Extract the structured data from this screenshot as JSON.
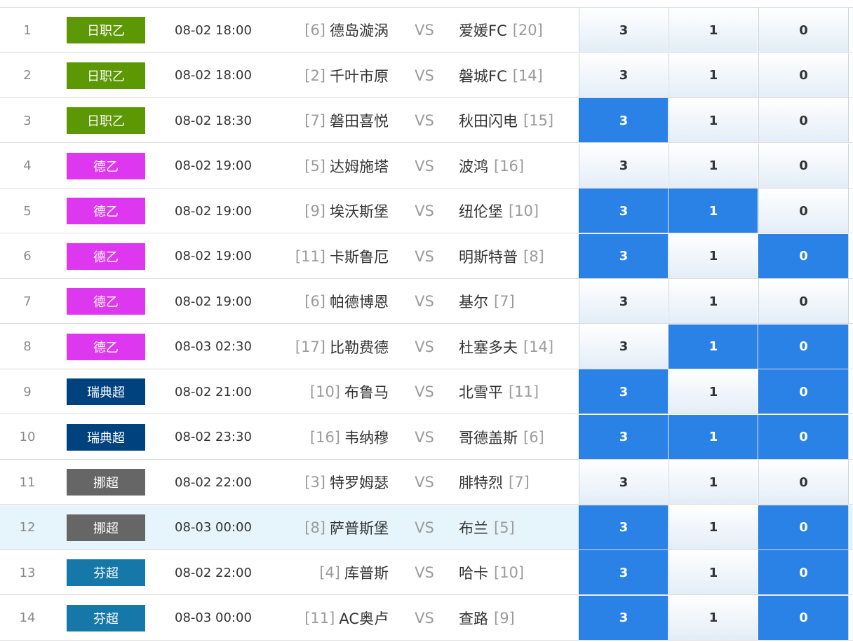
{
  "league_colors": {
    "日职乙": "#5b9803",
    "德乙": "#de37f0",
    "瑞典超": "#00427e",
    "挪超": "#666666",
    "芬超": "#1678a9"
  },
  "selected_color": "#2a81e6",
  "highlighted_row": 12,
  "rows": [
    {
      "num": "1",
      "league": "日职乙",
      "time": "08-02 18:00",
      "home_rank": "[6]",
      "home": "德岛漩涡",
      "vs": "VS",
      "away": "爱媛FC",
      "away_rank": "[20]",
      "odds": [
        "3",
        "1",
        "0"
      ],
      "selected": [
        false,
        false,
        false
      ]
    },
    {
      "num": "2",
      "league": "日职乙",
      "time": "08-02 18:00",
      "home_rank": "[2]",
      "home": "千叶市原",
      "vs": "VS",
      "away": "磐城FC",
      "away_rank": "[14]",
      "odds": [
        "3",
        "1",
        "0"
      ],
      "selected": [
        false,
        false,
        false
      ]
    },
    {
      "num": "3",
      "league": "日职乙",
      "time": "08-02 18:30",
      "home_rank": "[7]",
      "home": "磐田喜悦",
      "vs": "VS",
      "away": "秋田闪电",
      "away_rank": "[15]",
      "odds": [
        "3",
        "1",
        "0"
      ],
      "selected": [
        true,
        false,
        false
      ]
    },
    {
      "num": "4",
      "league": "德乙",
      "time": "08-02 19:00",
      "home_rank": "[5]",
      "home": "达姆施塔",
      "vs": "VS",
      "away": "波鸿",
      "away_rank": "[16]",
      "odds": [
        "3",
        "1",
        "0"
      ],
      "selected": [
        false,
        false,
        false
      ]
    },
    {
      "num": "5",
      "league": "德乙",
      "time": "08-02 19:00",
      "home_rank": "[9]",
      "home": "埃沃斯堡",
      "vs": "VS",
      "away": "纽伦堡",
      "away_rank": "[10]",
      "odds": [
        "3",
        "1",
        "0"
      ],
      "selected": [
        true,
        true,
        false
      ]
    },
    {
      "num": "6",
      "league": "德乙",
      "time": "08-02 19:00",
      "home_rank": "[11]",
      "home": "卡斯鲁厄",
      "vs": "VS",
      "away": "明斯特普",
      "away_rank": "[8]",
      "odds": [
        "3",
        "1",
        "0"
      ],
      "selected": [
        true,
        false,
        true
      ]
    },
    {
      "num": "7",
      "league": "德乙",
      "time": "08-02 19:00",
      "home_rank": "[6]",
      "home": "帕德博恩",
      "vs": "VS",
      "away": "基尔",
      "away_rank": "[7]",
      "odds": [
        "3",
        "1",
        "0"
      ],
      "selected": [
        false,
        false,
        false
      ]
    },
    {
      "num": "8",
      "league": "德乙",
      "time": "08-03 02:30",
      "home_rank": "[17]",
      "home": "比勒费德",
      "vs": "VS",
      "away": "杜塞多夫",
      "away_rank": "[14]",
      "odds": [
        "3",
        "1",
        "0"
      ],
      "selected": [
        false,
        true,
        true
      ]
    },
    {
      "num": "9",
      "league": "瑞典超",
      "time": "08-02 21:00",
      "home_rank": "[10]",
      "home": "布鲁马",
      "vs": "VS",
      "away": "北雪平",
      "away_rank": "[11]",
      "odds": [
        "3",
        "1",
        "0"
      ],
      "selected": [
        true,
        false,
        true
      ]
    },
    {
      "num": "10",
      "league": "瑞典超",
      "time": "08-02 23:30",
      "home_rank": "[16]",
      "home": "韦纳穆",
      "vs": "VS",
      "away": "哥德盖斯",
      "away_rank": "[6]",
      "odds": [
        "3",
        "1",
        "0"
      ],
      "selected": [
        true,
        true,
        true
      ]
    },
    {
      "num": "11",
      "league": "挪超",
      "time": "08-02 22:00",
      "home_rank": "[3]",
      "home": "特罗姆瑟",
      "vs": "VS",
      "away": "腓特烈",
      "away_rank": "[7]",
      "odds": [
        "3",
        "1",
        "0"
      ],
      "selected": [
        false,
        false,
        false
      ]
    },
    {
      "num": "12",
      "league": "挪超",
      "time": "08-03 00:00",
      "home_rank": "[8]",
      "home": "萨普斯堡",
      "vs": "VS",
      "away": "布兰",
      "away_rank": "[5]",
      "odds": [
        "3",
        "1",
        "0"
      ],
      "selected": [
        true,
        false,
        true
      ]
    },
    {
      "num": "13",
      "league": "芬超",
      "time": "08-02 22:00",
      "home_rank": "[4]",
      "home": "库普斯",
      "vs": "VS",
      "away": "哈卡",
      "away_rank": "[10]",
      "odds": [
        "3",
        "1",
        "0"
      ],
      "selected": [
        true,
        false,
        true
      ]
    },
    {
      "num": "14",
      "league": "芬超",
      "time": "08-03 00:00",
      "home_rank": "[11]",
      "home": "AC奥卢",
      "vs": "VS",
      "away": "查路",
      "away_rank": "[9]",
      "odds": [
        "3",
        "1",
        "0"
      ],
      "selected": [
        true,
        false,
        true
      ]
    }
  ]
}
